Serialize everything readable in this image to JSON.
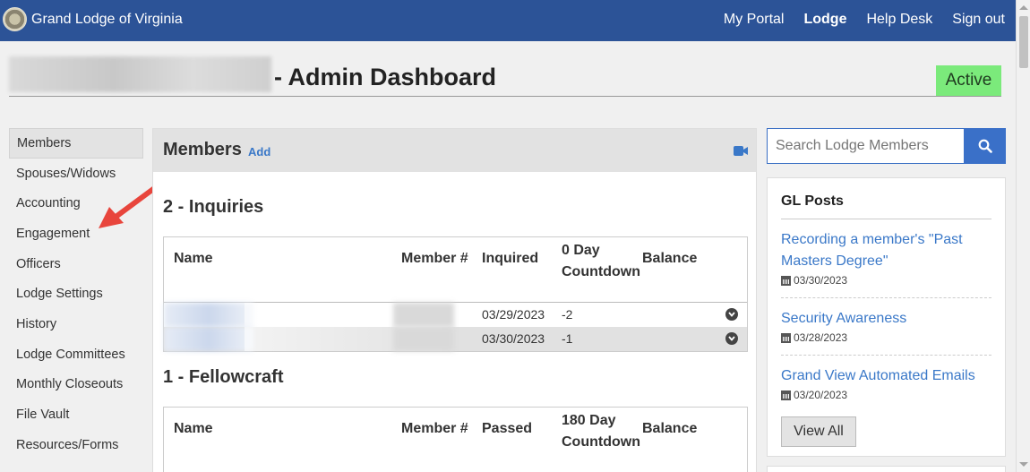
{
  "navbar": {
    "brand": "Grand Lodge of Virginia",
    "links": [
      {
        "label": "My Portal"
      },
      {
        "label": "Lodge",
        "active": true
      },
      {
        "label": "Help Desk"
      },
      {
        "label": "Sign out"
      }
    ],
    "color": "#2c5397"
  },
  "header": {
    "title": "- Admin Dashboard",
    "status": "Active",
    "status_color": "#7bea7b"
  },
  "sidebar": {
    "items": [
      {
        "label": "Members",
        "active": true
      },
      {
        "label": "Spouses/Widows"
      },
      {
        "label": "Accounting"
      },
      {
        "label": "Engagement"
      },
      {
        "label": "Officers"
      },
      {
        "label": "Lodge Settings"
      },
      {
        "label": "History"
      },
      {
        "label": "Lodge Committees"
      },
      {
        "label": "Monthly Closeouts"
      },
      {
        "label": "File Vault"
      },
      {
        "label": "Resources/Forms"
      }
    ]
  },
  "members_panel": {
    "title": "Members",
    "add_label": "Add",
    "video_icon": "video-camera-icon",
    "inquiries": {
      "title": "2 - Inquiries",
      "columns": [
        "Name",
        "Member #",
        "Inquired",
        "0 Day Countdown",
        "Balance"
      ],
      "rows": [
        {
          "date": "03/29/2023",
          "countdown": "-2"
        },
        {
          "date": "03/30/2023",
          "countdown": "-1"
        }
      ]
    },
    "fellowcraft": {
      "title": "1 - Fellowcraft",
      "columns": [
        "Name",
        "Member #",
        "Passed",
        "180 Day Countdown",
        "Balance"
      ]
    }
  },
  "search": {
    "placeholder": "Search Lodge Members",
    "icon": "search-icon"
  },
  "gl_posts": {
    "title": "GL Posts",
    "posts": [
      {
        "title": "Recording a member's \"Past Masters Degree\"",
        "date": "03/30/2023"
      },
      {
        "title": "Security Awareness",
        "date": "03/28/2023"
      },
      {
        "title": "Grand View Automated Emails",
        "date": "03/20/2023"
      }
    ],
    "view_all_label": "View All"
  }
}
